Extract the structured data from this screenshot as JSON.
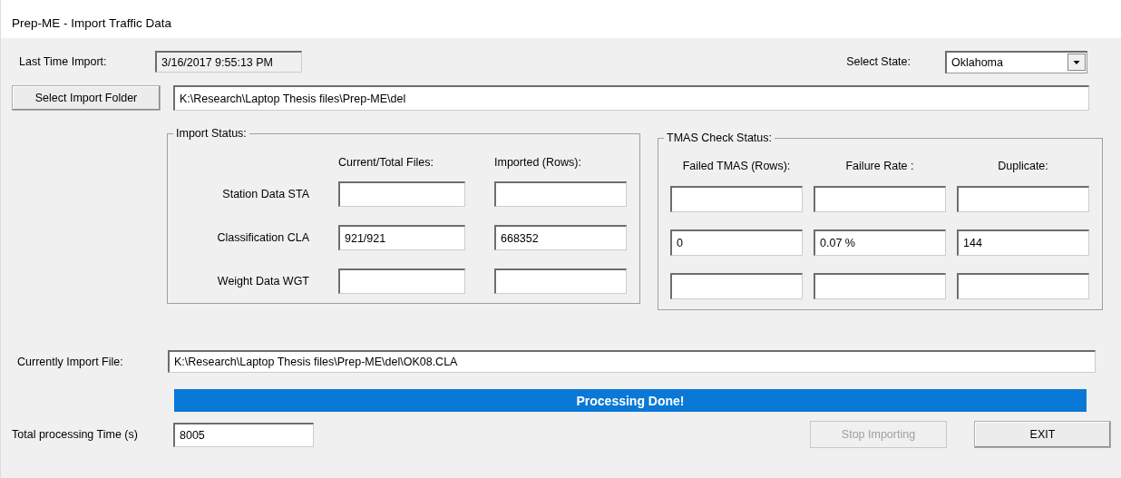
{
  "window": {
    "title": "Prep-ME - Import Traffic Data"
  },
  "last_import": {
    "label": "Last Time Import:",
    "value": "3/16/2017 9:55:13 PM",
    "read_only": true
  },
  "state_select": {
    "label": "Select State:",
    "value": "Oklahoma"
  },
  "folder": {
    "button": "Select Import Folder",
    "value": "K:\\Research\\Laptop Thesis files\\Prep-ME\\del"
  },
  "import_status": {
    "title": "Import Status:",
    "columns": [
      "Current/Total Files:",
      "Imported (Rows):"
    ],
    "rows": [
      {
        "label": "Station Data STA"
      },
      {
        "label": "Classification CLA",
        "values": [
          "921/921",
          "668352"
        ]
      },
      {
        "label": "Weight Data WGT"
      }
    ]
  },
  "tmas_status": {
    "title": "TMAS Check Status:",
    "columns": [
      "Failed TMAS (Rows):",
      "Failure Rate :",
      "Duplicate:"
    ],
    "rows": [
      {},
      {
        "values": [
          "0",
          "0.07 %",
          "144"
        ]
      },
      {}
    ]
  },
  "current_file": {
    "label": "Currently Import File:",
    "value": "K:\\Research\\Laptop Thesis files\\Prep-ME\\del\\OK08.CLA"
  },
  "progress": {
    "text": "Processing Done!",
    "level": 1
  },
  "total_time": {
    "label": "Total processing Time (s)",
    "value": "8005"
  },
  "buttons": [
    {
      "label": "Stop Importing",
      "disabled": true
    },
    {
      "label": "EXIT",
      "disabled": false
    }
  ]
}
